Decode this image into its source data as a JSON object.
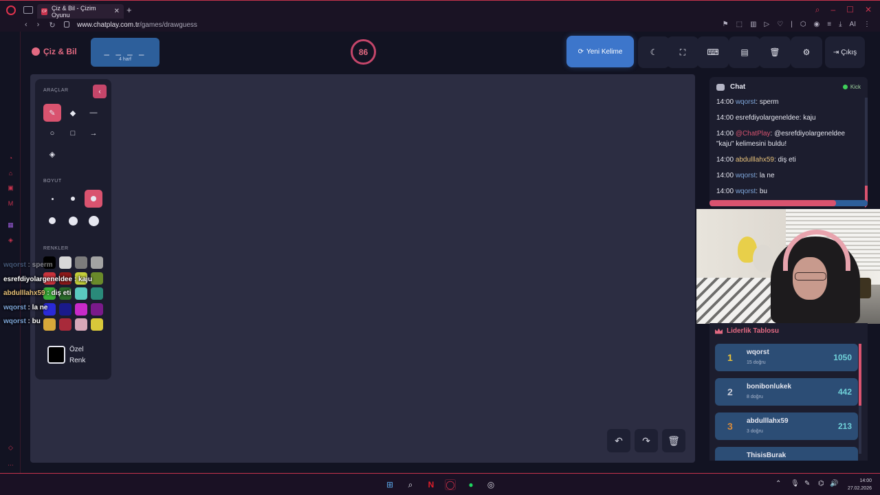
{
  "browser": {
    "tab_title": "Çiz & Bil - Çizim Oyunu",
    "tab_favicon": "CP",
    "url_domain": "www.chatplay.com.tr",
    "url_path": "/games/drawguess",
    "ext_ai": "AI"
  },
  "app": {
    "logo_text": "Çiz & Bil",
    "word_mask": "_ _ _ _",
    "word_hint": "4 harf",
    "timer": "86",
    "new_word_label": "Yeni Kelime",
    "exit_label": "Çıkış"
  },
  "tools": {
    "section_tools": "ARAÇLAR",
    "section_size": "BOYUT",
    "section_colors": "RENKLER",
    "custom_color_label": "Özel Renk",
    "colors": [
      "#000000",
      "#d8d8d8",
      "#7c7c7c",
      "#a3a3a3",
      "#c8333c",
      "#8b1a1a",
      "#c3cf3a",
      "#6a8a2a",
      "#3ab03a",
      "#2a6a2a",
      "#5ac8c0",
      "#2a8a7a",
      "#2a2ad8",
      "#1a1a8a",
      "#c82ac8",
      "#7a1a8a",
      "#d8a83a",
      "#a82a3a",
      "#d8a8b8",
      "#d8c83a"
    ]
  },
  "overlay_chat": [
    {
      "user": "wqorst",
      "text": "sperm",
      "color": "#7ea6da"
    },
    {
      "user": "esrefdiyolargeneldee",
      "text": "kaju",
      "color": "#ffffff"
    },
    {
      "user": "abdulllahx59",
      "text": "diş eti",
      "color": "#e8c27a"
    },
    {
      "user": "wqorst",
      "text": "la ne",
      "color": "#7ea6da"
    },
    {
      "user": "wqorst",
      "text": "bu",
      "color": "#7ea6da"
    }
  ],
  "chat": {
    "title": "Chat",
    "platform": "Kick",
    "progress": 0.8,
    "messages": [
      {
        "time": "14:00",
        "user": "wqorst",
        "text": ": sperm",
        "kind": "user"
      },
      {
        "time": "14:00",
        "user": "esrefdiyolargeneldee",
        "text": ": kaju",
        "kind": "plain"
      },
      {
        "time": "14:00",
        "user": "@ChatPlay",
        "text": ": @esrefdiyolargeneldee \"kaju\" kelimesini buldu!",
        "kind": "bot"
      },
      {
        "time": "14:00",
        "user": "abdulllahx59",
        "text": ": diş eti",
        "kind": "gold"
      },
      {
        "time": "14:00",
        "user": "wqorst",
        "text": ": la ne",
        "kind": "user"
      },
      {
        "time": "14:00",
        "user": "wqorst",
        "text": ": bu",
        "kind": "user"
      }
    ]
  },
  "leaderboard": {
    "title": "Liderlik Tablosu",
    "rows": [
      {
        "rank": "1",
        "name": "wqorst",
        "correct": "15 doğru",
        "score": "1050",
        "rank_color": "#e8c23a"
      },
      {
        "rank": "2",
        "name": "bonibonlukek",
        "correct": "8 doğru",
        "score": "442",
        "rank_color": "#c8ccd8"
      },
      {
        "rank": "3",
        "name": "abdulllahx59",
        "correct": "3 doğru",
        "score": "213",
        "rank_color": "#d88a3a"
      },
      {
        "rank": "",
        "name": "ThisisBurak",
        "correct": "",
        "score": "",
        "rank_color": "#c8ccd8"
      }
    ]
  },
  "taskbar": {
    "time": "14:00",
    "date": "27.02.2026"
  }
}
